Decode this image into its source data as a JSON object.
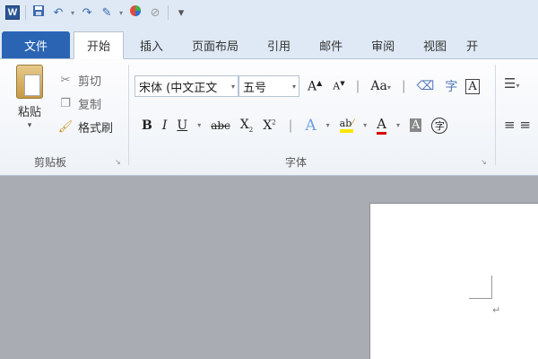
{
  "qat": {
    "app_letter": "W",
    "icons": [
      "save-icon",
      "undo-icon",
      "redo-icon",
      "format-painter-icon",
      "color-icon",
      "clear-icon",
      "customize-icon"
    ]
  },
  "tabs": [
    {
      "label": "文件"
    },
    {
      "label": "开始"
    },
    {
      "label": "插入"
    },
    {
      "label": "页面布局"
    },
    {
      "label": "引用"
    },
    {
      "label": "邮件"
    },
    {
      "label": "审阅"
    },
    {
      "label": "视图"
    },
    {
      "label": "开"
    }
  ],
  "clipboard": {
    "paste_label": "粘贴",
    "cut_label": "剪切",
    "copy_label": "复制",
    "format_painter_label": "格式刷",
    "group_label": "剪贴板"
  },
  "font": {
    "font_name": "宋体 (中文正文",
    "font_size": "五号",
    "grow": "A",
    "shrink": "A",
    "change_case": "Aa",
    "bold": "B",
    "italic": "I",
    "underline": "U",
    "strike": "abc",
    "subscript": "X",
    "superscript": "X",
    "font_color": "A",
    "shading": "A",
    "enclose": "字",
    "group_label": "字体"
  },
  "colors": {
    "file_tab": "#2a64b3",
    "highlight": "#ffe600",
    "font_color": "#d80000"
  }
}
